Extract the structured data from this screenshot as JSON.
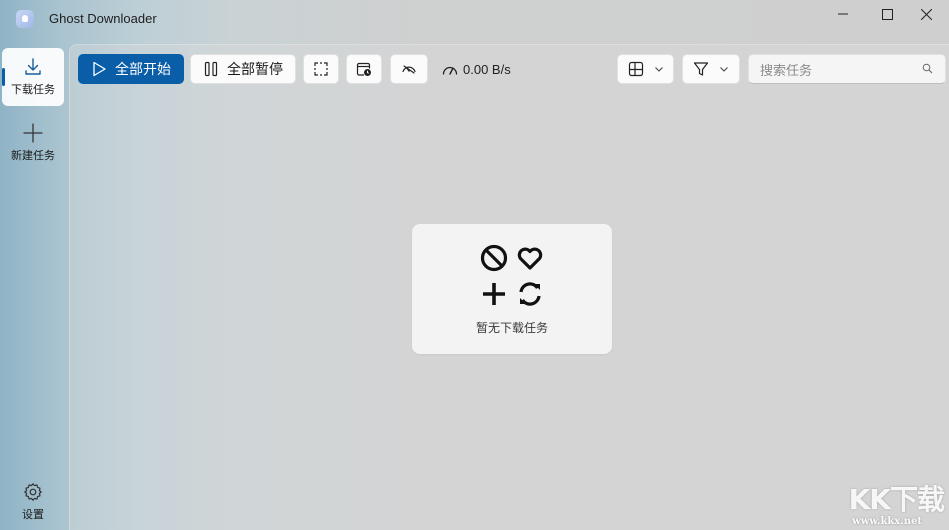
{
  "window": {
    "title": "Ghost Downloader"
  },
  "sidebar": {
    "items": [
      {
        "label": "下载任务",
        "icon": "download-icon",
        "active": true
      },
      {
        "label": "新建任务",
        "icon": "plus-icon",
        "active": false
      }
    ],
    "settings": {
      "label": "设置",
      "icon": "gear-icon"
    }
  },
  "toolbar": {
    "start_all_label": "全部开始",
    "pause_all_label": "全部暂停",
    "speed": "0.00 B/s",
    "search_placeholder": "搜索任务",
    "accent": "#0a5ea8"
  },
  "empty_state": {
    "message": "暂无下载任务"
  },
  "watermark": {
    "logo": "KK下载",
    "url": "www.kkx.net"
  }
}
